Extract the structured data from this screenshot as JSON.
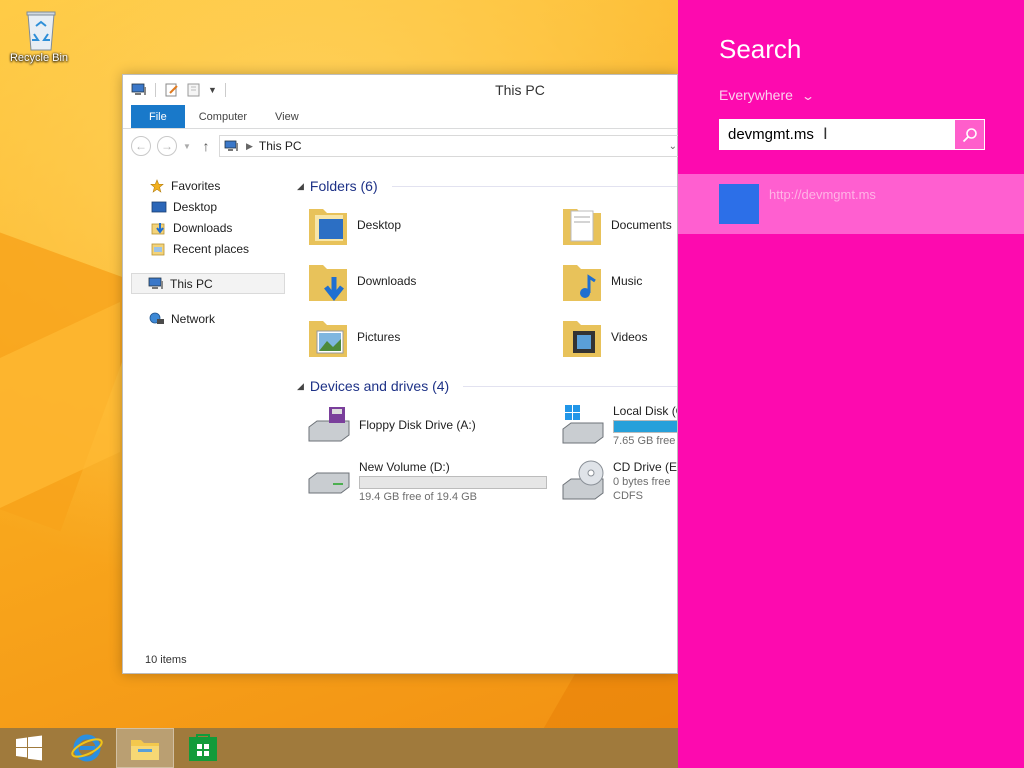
{
  "desktop": {
    "recycle_bin_label": "Recycle Bin"
  },
  "explorer": {
    "title": "This PC",
    "ribbon_tabs": [
      "File",
      "Computer",
      "View"
    ],
    "address": {
      "location": "This PC"
    },
    "nav": {
      "favorites": "Favorites",
      "desktop": "Desktop",
      "downloads": "Downloads",
      "recent_places": "Recent places",
      "this_pc": "This PC",
      "network": "Network"
    },
    "folders_group": "Folders (6)",
    "folders": [
      "Desktop",
      "Documents",
      "Downloads",
      "Music",
      "Pictures",
      "Videos"
    ],
    "devices_group": "Devices and drives (4)",
    "devices": [
      {
        "name": "Floppy Disk Drive (A:)",
        "free": "",
        "fs": "",
        "fill": null
      },
      {
        "name": "Local Disk (C",
        "free": "7.65 GB free",
        "fs": "",
        "fill": 0.95
      },
      {
        "name": "New Volume (D:)",
        "free": "19.4 GB free of 19.4 GB",
        "fs": "",
        "fill": 0.0
      },
      {
        "name": "CD Drive (E:",
        "free": "0 bytes free",
        "fs": "CDFS",
        "fill": null
      }
    ],
    "status": "10 items"
  },
  "charm": {
    "title": "Search",
    "scope": "Everywhere",
    "query": "devmgmt.ms",
    "result": "http://devmgmt.ms"
  },
  "colors": {
    "charm_bg": "#fd0aaf",
    "result_highlight": "#ff5fd0",
    "result_tile": "#2c6fe8",
    "file_tab": "#1979ca",
    "drive_bar": "#26a0da"
  }
}
